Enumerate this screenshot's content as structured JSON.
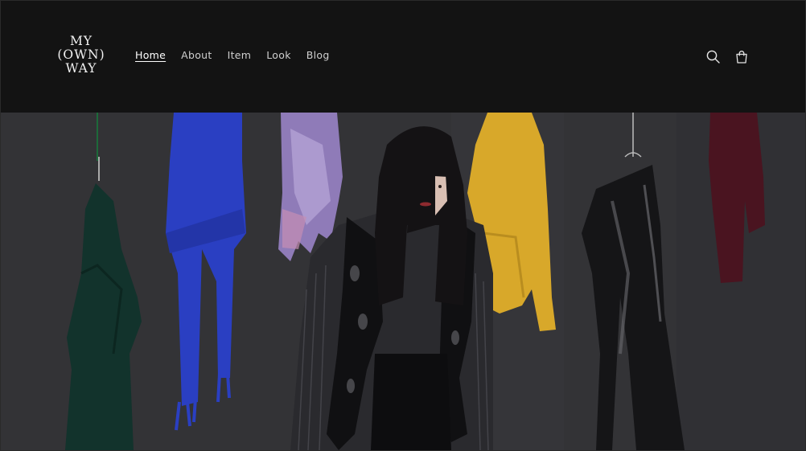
{
  "brand": {
    "logo_lines": [
      "MY",
      "(OWN)",
      "WAY"
    ]
  },
  "nav": {
    "items": [
      {
        "label": "Home",
        "active": true
      },
      {
        "label": "About",
        "active": false
      },
      {
        "label": "Item",
        "active": false
      },
      {
        "label": "Look",
        "active": false
      },
      {
        "label": "Blog",
        "active": false
      }
    ]
  },
  "header_icons": {
    "search": "search-icon",
    "cart": "cart-icon"
  },
  "colors": {
    "header_bg": "#131313",
    "text": "#f2f2f2",
    "nav_text": "#cfcfcf",
    "backdrop": "#333336",
    "green_sweater": "#12332c",
    "blue_scarf": "#2a3fc2",
    "yellow_cardigan": "#d8a82a",
    "burgundy_knit": "#4a1420"
  }
}
